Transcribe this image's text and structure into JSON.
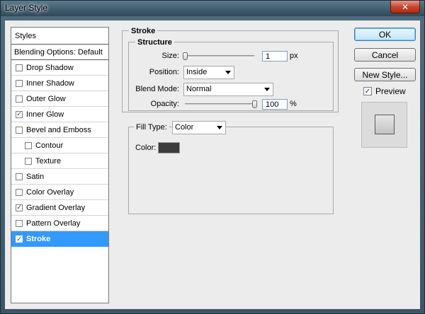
{
  "window": {
    "title": "Layer Style",
    "close_glyph": "✕"
  },
  "styles_panel": {
    "header": "Styles",
    "blending_options": "Blending Options: Default",
    "items": [
      {
        "label": "Drop Shadow",
        "checked": false,
        "sub": false,
        "selected": false
      },
      {
        "label": "Inner Shadow",
        "checked": false,
        "sub": false,
        "selected": false
      },
      {
        "label": "Outer Glow",
        "checked": false,
        "sub": false,
        "selected": false
      },
      {
        "label": "Inner Glow",
        "checked": true,
        "sub": false,
        "selected": false
      },
      {
        "label": "Bevel and Emboss",
        "checked": false,
        "sub": false,
        "selected": false
      },
      {
        "label": "Contour",
        "checked": false,
        "sub": true,
        "selected": false
      },
      {
        "label": "Texture",
        "checked": false,
        "sub": true,
        "selected": false
      },
      {
        "label": "Satin",
        "checked": false,
        "sub": false,
        "selected": false
      },
      {
        "label": "Color Overlay",
        "checked": false,
        "sub": false,
        "selected": false
      },
      {
        "label": "Gradient Overlay",
        "checked": true,
        "sub": false,
        "selected": false
      },
      {
        "label": "Pattern Overlay",
        "checked": false,
        "sub": false,
        "selected": false
      },
      {
        "label": "Stroke",
        "checked": true,
        "sub": false,
        "selected": true
      }
    ]
  },
  "stroke": {
    "title": "Stroke",
    "structure_title": "Structure",
    "size_label": "Size:",
    "size_value": "1",
    "size_unit": "px",
    "size_slider_level": 0.0,
    "position_label": "Position:",
    "position_value": "Inside",
    "blend_mode_label": "Blend Mode:",
    "blend_mode_value": "Normal",
    "opacity_label": "Opacity:",
    "opacity_value": "100",
    "opacity_unit": "%",
    "opacity_slider_level": 1.0,
    "fill_type_label": "Fill Type:",
    "fill_type_value": "Color",
    "color_label": "Color:",
    "color_value": "#3c3c3c"
  },
  "buttons": {
    "ok": "OK",
    "cancel": "Cancel",
    "new_style": "New Style...",
    "preview_label": "Preview",
    "preview_checked": true
  }
}
